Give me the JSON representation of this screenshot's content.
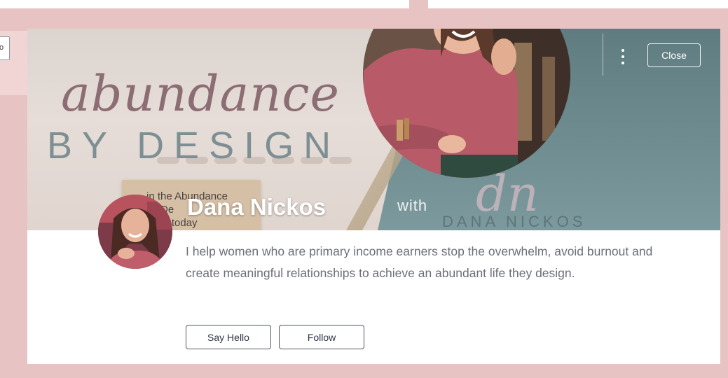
{
  "banner": {
    "script_word": "abundance",
    "by_design": "BY DESIGN",
    "with_text": "with",
    "host_name_caps": "DANA NICKOS",
    "note_lines": [
      "in the Abundance",
      "by De",
      "unity today"
    ]
  },
  "header": {
    "more_label": "⋮",
    "close_label": "Close"
  },
  "profile": {
    "name": "Dana Nickos",
    "bio": "I help women who are primary income earners stop the overwhelm, avoid burnout and create meaningful relationships to achieve an abundant life they design."
  },
  "actions": {
    "say_hello_label": "Say Hello",
    "follow_label": "Follow"
  },
  "background": {
    "input_value": "o"
  },
  "colors": {
    "page_background": "#e8c3c3",
    "banner_teal": "#6f8d92",
    "text_muted": "#6b6f78",
    "button_border": "#4f5766"
  }
}
